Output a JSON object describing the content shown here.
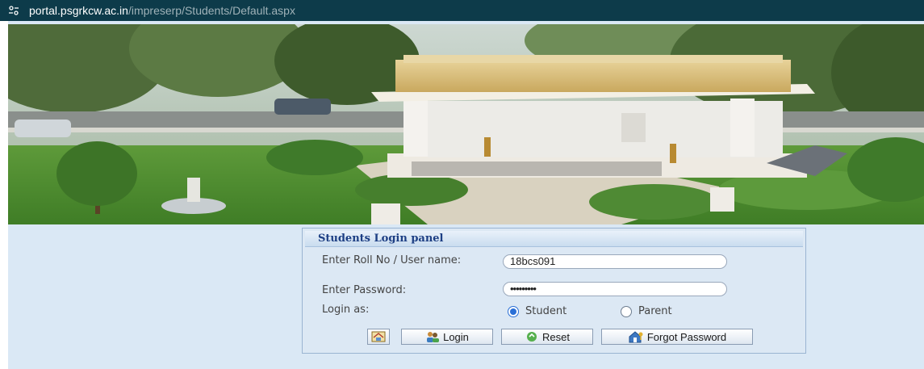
{
  "browser": {
    "url_domain": "portal.psgrkcw.ac.in",
    "url_path": "/impreserp/Students/Default.aspx"
  },
  "login_panel": {
    "title": "Students Login panel",
    "roll_label": "Enter Roll No / User name:",
    "roll_value": "18bcs091",
    "password_label": "Enter Password:",
    "password_value": "•••••••••",
    "login_as_label": "Login as:",
    "options": [
      {
        "label": "Student",
        "selected": true
      },
      {
        "label": "Parent",
        "selected": false
      }
    ],
    "buttons": {
      "home_icon": "home-icon",
      "login": "Login",
      "reset": "Reset",
      "forgot": "Forgot Password"
    }
  }
}
